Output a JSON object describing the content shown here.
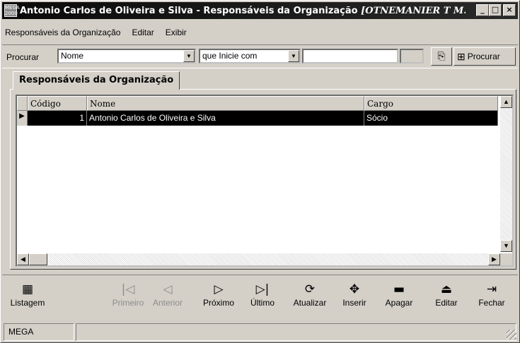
{
  "window": {
    "title_main": "Antonio Carlos de Oliveira e Silva -  Responsáveis da Organização ",
    "title_italic": "[OTNEMANIER T M...",
    "app_icon_text": "MEGA 2000",
    "minimize": "_",
    "maximize": "□",
    "close": "×"
  },
  "menu": [
    "Responsáveis da Organização",
    "Editar",
    "Exibir"
  ],
  "search": {
    "label": "Procurar",
    "field_value": "Nome",
    "condition_value": "que Inicie com",
    "text_value": "",
    "button_label": "Procurar"
  },
  "tab": {
    "label": "Responsáveis da Organização"
  },
  "table": {
    "columns": [
      "Código",
      "Nome",
      "Cargo"
    ],
    "rows": [
      {
        "codigo": "1",
        "nome": "Antonio Carlos de Oliveira e Silva",
        "cargo": "Sócio"
      }
    ]
  },
  "nav": {
    "listagem": "Listagem",
    "primeiro": "Primeiro",
    "anterior": "Anterior",
    "proximo": "Próximo",
    "ultimo": "Último",
    "atualizar": "Atualizar",
    "inserir": "Inserir",
    "apagar": "Apagar",
    "editar": "Editar",
    "fechar": "Fechar"
  },
  "status": {
    "panel1": "MEGA",
    "panel2": ""
  }
}
